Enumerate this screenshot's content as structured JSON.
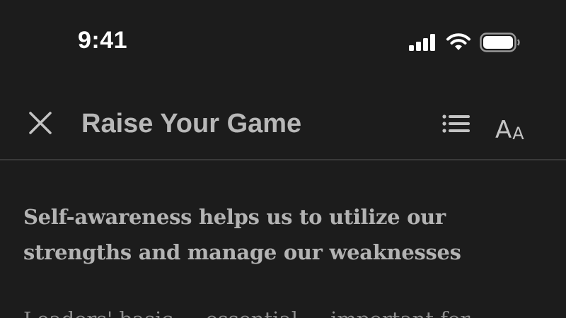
{
  "status_bar": {
    "time": "9:41",
    "icons": [
      "cellular-signal-icon",
      "wifi-icon",
      "battery-icon"
    ]
  },
  "header": {
    "title": "Raise Your Game",
    "close_icon": "close-icon",
    "toc_icon": "list-icon",
    "font_settings": {
      "large_letter": "A",
      "small_letter": "A"
    }
  },
  "content": {
    "subheading": "Self-awareness helps us to utilize our strengths and manage our weaknesses",
    "body_partial": "Leaders' basic ... essential ... important for"
  },
  "colors": {
    "background": "#1c1c1c",
    "title_text": "#b8b8b8",
    "subheading_text": "#b3b3b3",
    "divider": "#3a3a3a",
    "status_text": "#ffffff"
  }
}
